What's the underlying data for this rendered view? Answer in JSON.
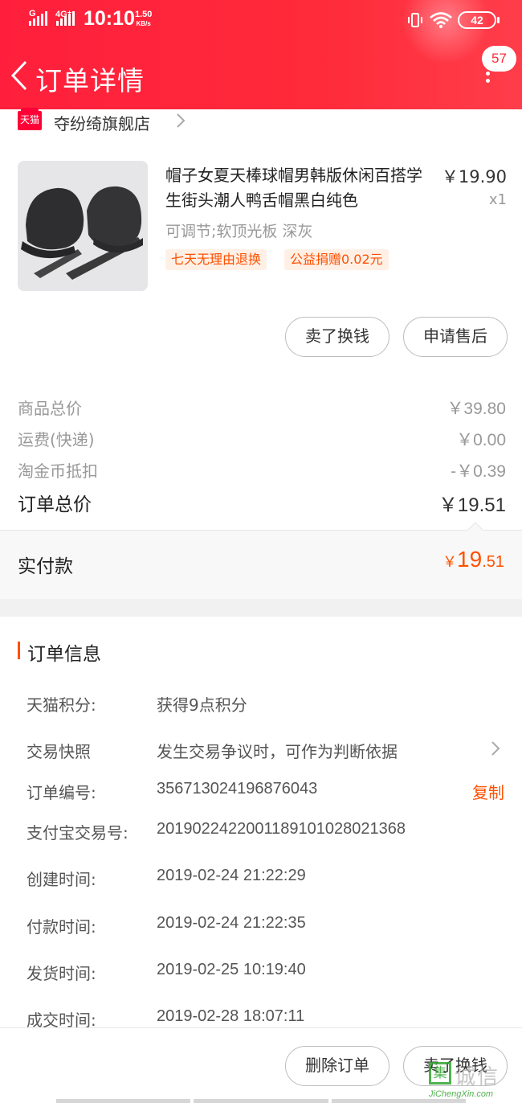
{
  "status_bar": {
    "signal_1": "G",
    "signal_2": "4G⁺",
    "time": "10:10",
    "speed_value": "1.50",
    "speed_unit": "KB/s",
    "battery": "42"
  },
  "nav": {
    "title": "订单详情",
    "message_count": "57"
  },
  "store": {
    "badge": "天猫",
    "name": "夺纷绮旗舰店"
  },
  "product": {
    "title": "帽子女夏天棒球帽男韩版休闲百搭学生街头潮人鸭舌帽黑白纯色",
    "price": "￥19.90",
    "quantity": "x1",
    "sku": "可调节;软顶光板 深灰",
    "tags": [
      "七天无理由退换",
      "公益捐赠0.02元"
    ],
    "buttons": {
      "sell": "卖了换钱",
      "after_sale": "申请售后"
    }
  },
  "summary": {
    "goods_total_label": "商品总价",
    "goods_total_value": "￥39.80",
    "shipping_label": "运费(快递)",
    "shipping_value": "￥0.00",
    "coin_label": "淘金币抵扣",
    "coin_value": "-￥0.39",
    "order_total_label": "订单总价",
    "order_total_value": "￥19.51"
  },
  "paid": {
    "label": "实付款",
    "currency": "￥",
    "integer": "19",
    "decimal": ".51"
  },
  "order_info": {
    "heading": "订单信息",
    "points_label": "天猫积分:",
    "points_value": "获得9点积分",
    "snapshot_label": "交易快照",
    "snapshot_value": "发生交易争议时，可作为判断依据",
    "order_no_label": "订单编号:",
    "order_no_value": "356713024196876043",
    "copy_label": "复制",
    "alipay_label": "支付宝交易号:",
    "alipay_value": "2019022422001189101028021368",
    "created_label": "创建时间:",
    "created_value": "2019-02-24 21:22:29",
    "paid_label": "付款时间:",
    "paid_value": "2019-02-24 21:22:35",
    "shipped_label": "发货时间:",
    "shipped_value": "2019-02-25 10:19:40",
    "closed_label": "成交时间:",
    "closed_value": "2019-02-28 18:07:11"
  },
  "bottom": {
    "delete_label": "删除订单",
    "sell_label": "卖了换钱"
  },
  "watermark": {
    "mark": "集",
    "cn": "诚信",
    "en": "JiChengXin.com"
  },
  "colors": {
    "header_red": "#ff2a3a",
    "accent_orange": "#ff5000",
    "tag_bg": "#fff0e6"
  }
}
